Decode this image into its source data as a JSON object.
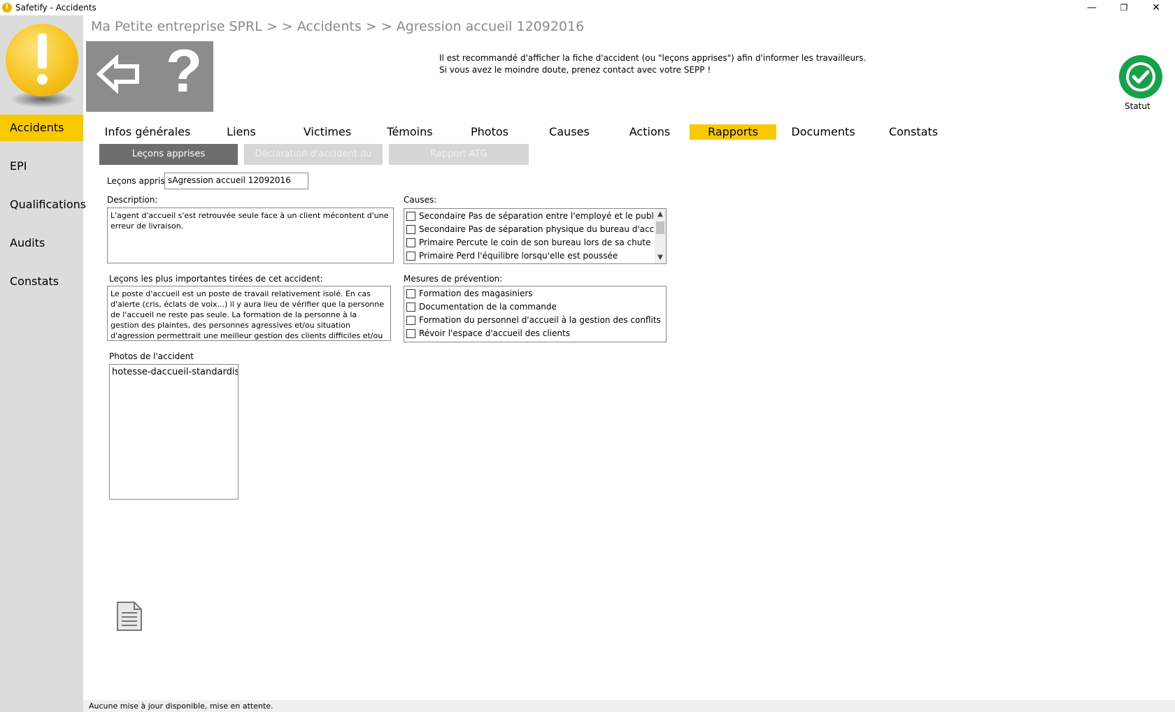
{
  "window": {
    "title": "Safetify - Accidents",
    "minimize": "—",
    "restore": "❐",
    "close": "✕"
  },
  "sidebar": {
    "items": [
      {
        "label": "Accidents",
        "active": true
      },
      {
        "label": "EPI"
      },
      {
        "label": "Qualifications"
      },
      {
        "label": "Audits"
      },
      {
        "label": "Constats"
      }
    ]
  },
  "header": {
    "breadcrumb": "Ma Petite entreprise SPRL > > Accidents > > Agression accueil 12092016",
    "help_glyph": "?",
    "notice_line1": "Il est recommandé d'afficher la fiche d'accident (ou \"leçons apprises\") afin d'informer les travailleurs.",
    "notice_line2": "Si vous avez le moindre doute, prenez contact avec votre SEPP !",
    "status_label": "Statut"
  },
  "tabs": [
    {
      "label": "Infos générales"
    },
    {
      "label": "Liens"
    },
    {
      "label": "Victimes"
    },
    {
      "label": "Témoins"
    },
    {
      "label": "Photos"
    },
    {
      "label": "Causes"
    },
    {
      "label": "Actions"
    },
    {
      "label": "Rapports",
      "active": true
    },
    {
      "label": "Documents"
    },
    {
      "label": "Constats"
    }
  ],
  "subtabs": [
    {
      "label": "Leçons apprises",
      "active": true
    },
    {
      "label": "Déclaration d'accident du",
      "disabled": true
    },
    {
      "label": "Rapport ATG",
      "disabled": true
    }
  ],
  "form": {
    "lecons_label": "Leçons apprises",
    "lecons_value": "sAgression accueil 12092016",
    "description_label": "Description:",
    "description_value": "L'agent d'accueil s'est retrouvée seule face à un client mécontent d'une erreur de livraison.",
    "important_label": "Leçons les plus importantes tirées de cet accident:",
    "important_value": "Le poste d'accueil est un poste de travail relativement isolé. En cas d'alerte (cris, éclats de voix...) il y aura lieu de vérifier que la personne de l'accueil ne reste pas seule. La formation de la personne à la gestion des plaintes, des personnes agressives et/ou situation d'agression permettrait une meilleur gestion des clients difficiles et/ou violents.",
    "causes_label": "Causes:",
    "causes": [
      "Secondaire Pas de séparation entre l'employé et le public",
      "Secondaire Pas de séparation physique du bureau d'accueil",
      "Primaire Percute le coin de son bureau lors de sa chute",
      "Primaire Perd l'équilibre lorsqu'elle est poussée"
    ],
    "mesures_label": "Mesures de prévention:",
    "mesures": [
      "Formation des magasiniers",
      "Documentation de la commande",
      "Formation du personnel d'accueil à la gestion des conflits",
      "Révoir l'espace d'accueil des clients"
    ],
    "photos_label": "Photos de l'accident",
    "photos": [
      "hotesse-daccueil-standardiste"
    ]
  },
  "statusbar": {
    "text": "Aucune mise à jour disponible, mise en attente."
  },
  "colors": {
    "accent": "#f9c900",
    "status_ok": "#15a24a",
    "sidebar_bg": "#dcdcdc",
    "subtab_active": "#6d6d6d",
    "subtab_disabled": "#d6d6d6"
  }
}
